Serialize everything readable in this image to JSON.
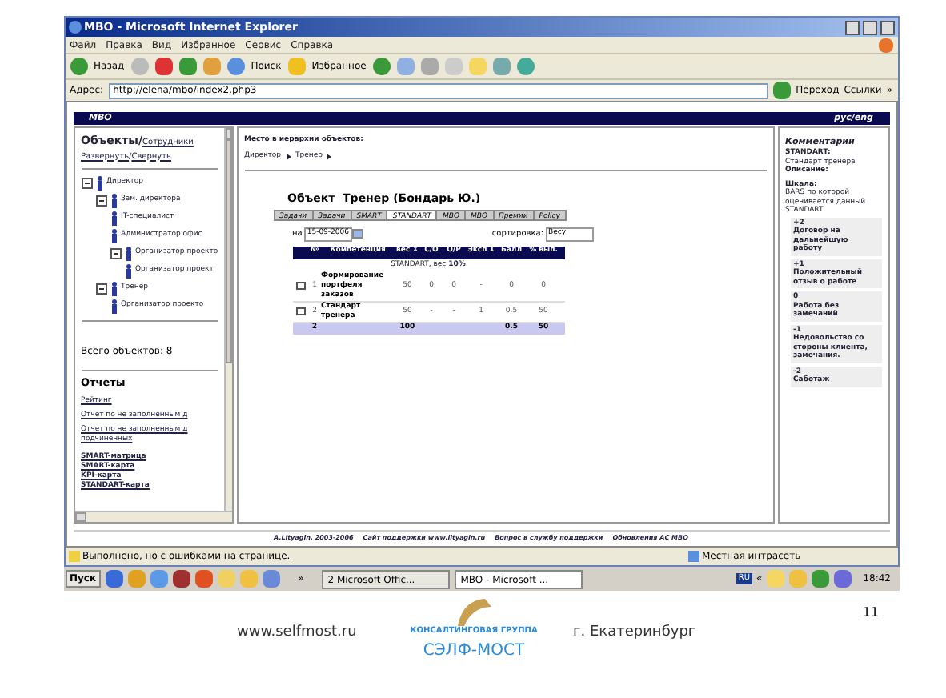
{
  "window": {
    "title": "MBO - Microsoft Internet Explorer"
  },
  "menu": [
    "Файл",
    "Правка",
    "Вид",
    "Избранное",
    "Сервис",
    "Справка"
  ],
  "toolbar": {
    "back": "Назад",
    "search": "Поиск",
    "favorites": "Избранное"
  },
  "address": {
    "label": "Адрес:",
    "value": "http://elena/mbo/index2.php3",
    "go": "Переход",
    "links": "Ссылки",
    "more": "»"
  },
  "app_header": {
    "title": "MBO",
    "lang": "рус/eng"
  },
  "sidebar": {
    "heading": "Объекты/",
    "heading_link": "Сотрудники",
    "toggle": [
      {
        "label": "Развернуть"
      },
      {
        "label": "Свернуть"
      }
    ],
    "toggle_separator": "/",
    "tree": [
      {
        "label": "Директор",
        "expanded": true,
        "children": [
          {
            "label": "Зам. директора",
            "expanded": true,
            "children": [
              {
                "label": "IT-специалист"
              },
              {
                "label": "Администратор офис"
              },
              {
                "label": "Организатор проекто",
                "expanded": true,
                "children": [
                  {
                    "label": "Организатор проект"
                  }
                ]
              }
            ]
          },
          {
            "label": "Тренер",
            "expanded": true,
            "children": [
              {
                "label": "Организатор проекто"
              }
            ]
          }
        ]
      }
    ],
    "total": "Всего объектов: 8",
    "reports_heading": "Отчеты",
    "reports": [
      "Рейтинг",
      "Отчёт по не заполненным д",
      "Отчет по не заполненным д подчинённых"
    ],
    "cards": [
      "SMART-матрица",
      "SMART-карта",
      "KPI-карта",
      "STANDART-карта"
    ]
  },
  "main": {
    "place_label": "Место в иерархии объектов:",
    "breadcrumb": [
      "Директор",
      "Тренер"
    ],
    "object_title": "Объект  Тренер (Бондарь Ю.)",
    "tabs": [
      {
        "label": "Задачи",
        "selected": false
      },
      {
        "label": "Задачи",
        "selected": false
      },
      {
        "label": "SMART",
        "selected": false
      },
      {
        "label": "STANDART",
        "selected": true
      },
      {
        "label": "МВО",
        "selected": false
      },
      {
        "label": "МВО",
        "selected": false
      },
      {
        "label": "Премии",
        "selected": false
      },
      {
        "label": "Policy",
        "selected": false
      }
    ],
    "date_label": "на",
    "date": "15-09-2006",
    "sort_label": "сортировка:",
    "sort": "Весу",
    "table": {
      "columns": [
        "№",
        "Компетенция",
        "вес ⇕",
        "С/О",
        "О/Р",
        "Эксп 1",
        "Балл",
        "% вып."
      ],
      "group": "STANDART, вес **10%**",
      "rows": [
        {
          "cells": [
            "1",
            "Формирование портфеля заказов",
            "50",
            "0",
            "0",
            "-",
            "0",
            "0"
          ]
        },
        {
          "cells": [
            "2",
            "Стандарт тренера",
            "50",
            "-",
            "-",
            "1",
            "0.5",
            "50"
          ]
        }
      ],
      "total": {
        "count": "2",
        "weight": "100",
        "score": "0.5",
        "percent": "50"
      }
    }
  },
  "comments": {
    "heading": "Комментарии",
    "standard_label": "STANDART:",
    "standard": "Стандарт тренера",
    "description_label": "Описание:",
    "scale_label": "Шкала:",
    "scale_note": "BARS по которой оценивается данный STANDART",
    "scale": [
      {
        "score": "+2",
        "text": "Договор на дальнейшую работу"
      },
      {
        "score": "+1",
        "text": "Положительный отзыв о работе"
      },
      {
        "score": "0",
        "text": "Работа без замечаний"
      },
      {
        "score": "-1",
        "text": "Недовольство со стороны клиента, замечания."
      },
      {
        "score": "-2",
        "text": "Саботаж"
      }
    ]
  },
  "page_footer": [
    "A.Lityagin, 2003-2006",
    "Сайт поддержки www.lityagin.ru",
    "Вопрос в службу поддержки",
    "Обновления АС МВО"
  ],
  "status_bar": {
    "text": "Выполнено, но с ошибками на странице.",
    "zone": "Местная интрасеть"
  },
  "taskbar": {
    "start": "Пуск",
    "more": "»",
    "tasks": [
      {
        "label": "2 Microsoft Offic...",
        "selected": false
      },
      {
        "label": "MBO - Microsoft ...",
        "selected": true
      }
    ],
    "lang": "RU",
    "tray_more": "«",
    "time": "18:42"
  },
  "slide": {
    "site": "www.selfmost.ru",
    "logo_top": "КОНСАЛТИНГОВАЯ ГРУППА",
    "logo_name": "СЭЛФ-МОСТ",
    "city": "г. Екатеринбург",
    "page": "11"
  }
}
